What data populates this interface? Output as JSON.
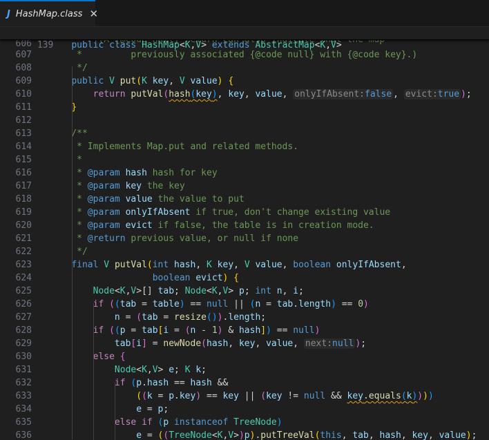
{
  "tab": {
    "label": "HashMap.class",
    "close_glyph": "✕",
    "icon_glyph": "J"
  },
  "sticky": {
    "line_number": "139",
    "parts": [
      [
        "k",
        "public"
      ],
      [
        "p",
        " "
      ],
      [
        "k",
        "class"
      ],
      [
        "p",
        " "
      ],
      [
        "t",
        "HashMap"
      ],
      [
        "p",
        "<"
      ],
      [
        "t",
        "K"
      ],
      [
        "p",
        ","
      ],
      [
        "t",
        "V"
      ],
      [
        "p",
        "> "
      ],
      [
        "k",
        "extends"
      ],
      [
        "p",
        " "
      ],
      [
        "t",
        "AbstractMap"
      ],
      [
        "p",
        "<"
      ],
      [
        "t",
        "K"
      ],
      [
        "p",
        ","
      ],
      [
        "t",
        "V"
      ],
      [
        "p",
        ">"
      ]
    ]
  },
  "lines": [
    {
      "n": "606",
      "clip": true,
      "parts": [
        [
          "cm",
          "         (A {@code null} return can also indicate that the map"
        ]
      ]
    },
    {
      "n": "607",
      "parts": [
        [
          "cm",
          "     *         previously associated {@code null} with {@code key}.)"
        ]
      ]
    },
    {
      "n": "608",
      "parts": [
        [
          "cm",
          "     */"
        ]
      ]
    },
    {
      "n": "609",
      "parts": [
        [
          "p",
          "    "
        ],
        [
          "k",
          "public"
        ],
        [
          "p",
          " "
        ],
        [
          "t",
          "V"
        ],
        [
          "p",
          " "
        ],
        [
          "f",
          "put"
        ],
        [
          "b1",
          "("
        ],
        [
          "t",
          "K"
        ],
        [
          "p",
          " "
        ],
        [
          "v",
          "key"
        ],
        [
          "p",
          ", "
        ],
        [
          "t",
          "V"
        ],
        [
          "p",
          " "
        ],
        [
          "v",
          "value"
        ],
        [
          "b1",
          ")"
        ],
        [
          "p",
          " "
        ],
        [
          "b1",
          "{"
        ]
      ]
    },
    {
      "n": "610",
      "parts": [
        [
          "p",
          "        "
        ],
        [
          "c",
          "return"
        ],
        [
          "p",
          " "
        ],
        [
          "f",
          "putVal"
        ],
        [
          "b2",
          "("
        ],
        [
          "squig",
          [
            [
              "f",
              "hash"
            ],
            [
              "b3",
              "("
            ],
            [
              "v",
              "key"
            ],
            [
              "b3",
              ")"
            ]
          ]
        ],
        [
          "p",
          ", "
        ],
        [
          "v",
          "key"
        ],
        [
          "p",
          ", "
        ],
        [
          "v",
          "value"
        ],
        [
          "p",
          ", "
        ],
        [
          "hint",
          [
            [
              "hn",
              "onlyIfAbsent:"
            ],
            [
              "hv",
              "false"
            ]
          ]
        ],
        [
          "p",
          ", "
        ],
        [
          "hint",
          [
            [
              "hn",
              "evict:"
            ],
            [
              "hv",
              "true"
            ]
          ]
        ],
        [
          "b2",
          ")"
        ],
        [
          "p",
          ";"
        ]
      ]
    },
    {
      "n": "611",
      "parts": [
        [
          "p",
          "    "
        ],
        [
          "b1",
          "}"
        ]
      ]
    },
    {
      "n": "612",
      "parts": []
    },
    {
      "n": "613",
      "parts": [
        [
          "cm",
          "    /**"
        ]
      ]
    },
    {
      "n": "614",
      "parts": [
        [
          "cm",
          "     * Implements Map.put and related methods."
        ]
      ]
    },
    {
      "n": "615",
      "parts": [
        [
          "cm",
          "     *"
        ]
      ]
    },
    {
      "n": "616",
      "parts": [
        [
          "cm",
          "     * "
        ],
        [
          "cmk",
          "@param"
        ],
        [
          "cm",
          " "
        ],
        [
          "v",
          "hash"
        ],
        [
          "cm",
          " hash for key"
        ]
      ]
    },
    {
      "n": "617",
      "parts": [
        [
          "cm",
          "     * "
        ],
        [
          "cmk",
          "@param"
        ],
        [
          "cm",
          " "
        ],
        [
          "v",
          "key"
        ],
        [
          "cm",
          " the key"
        ]
      ]
    },
    {
      "n": "618",
      "parts": [
        [
          "cm",
          "     * "
        ],
        [
          "cmk",
          "@param"
        ],
        [
          "cm",
          " "
        ],
        [
          "v",
          "value"
        ],
        [
          "cm",
          " the value to put"
        ]
      ]
    },
    {
      "n": "619",
      "parts": [
        [
          "cm",
          "     * "
        ],
        [
          "cmk",
          "@param"
        ],
        [
          "cm",
          " "
        ],
        [
          "v",
          "onlyIfAbsent"
        ],
        [
          "cm",
          " if true, don't change existing value"
        ]
      ]
    },
    {
      "n": "620",
      "parts": [
        [
          "cm",
          "     * "
        ],
        [
          "cmk",
          "@param"
        ],
        [
          "cm",
          " "
        ],
        [
          "v",
          "evict"
        ],
        [
          "cm",
          " if false, the table is in creation mode."
        ]
      ]
    },
    {
      "n": "621",
      "parts": [
        [
          "cm",
          "     * "
        ],
        [
          "cmk",
          "@return"
        ],
        [
          "cm",
          " previous value, or null if none"
        ]
      ]
    },
    {
      "n": "622",
      "parts": [
        [
          "cm",
          "     */"
        ]
      ]
    },
    {
      "n": "623",
      "parts": [
        [
          "p",
          "    "
        ],
        [
          "k",
          "final"
        ],
        [
          "p",
          " "
        ],
        [
          "t",
          "V"
        ],
        [
          "p",
          " "
        ],
        [
          "f",
          "putVal"
        ],
        [
          "b1",
          "("
        ],
        [
          "k",
          "int"
        ],
        [
          "p",
          " "
        ],
        [
          "v",
          "hash"
        ],
        [
          "p",
          ", "
        ],
        [
          "t",
          "K"
        ],
        [
          "p",
          " "
        ],
        [
          "v",
          "key"
        ],
        [
          "p",
          ", "
        ],
        [
          "t",
          "V"
        ],
        [
          "p",
          " "
        ],
        [
          "v",
          "value"
        ],
        [
          "p",
          ", "
        ],
        [
          "k",
          "boolean"
        ],
        [
          "p",
          " "
        ],
        [
          "v",
          "onlyIfAbsent"
        ],
        [
          "p",
          ","
        ]
      ]
    },
    {
      "n": "624",
      "parts": [
        [
          "p",
          "                   "
        ],
        [
          "k",
          "boolean"
        ],
        [
          "p",
          " "
        ],
        [
          "v",
          "evict"
        ],
        [
          "b1",
          ")"
        ],
        [
          "p",
          " "
        ],
        [
          "b1",
          "{"
        ]
      ]
    },
    {
      "n": "625",
      "parts": [
        [
          "p",
          "        "
        ],
        [
          "t",
          "Node"
        ],
        [
          "p",
          "<"
        ],
        [
          "t",
          "K"
        ],
        [
          "p",
          ","
        ],
        [
          "t",
          "V"
        ],
        [
          "p",
          ">[] "
        ],
        [
          "v",
          "tab"
        ],
        [
          "p",
          "; "
        ],
        [
          "t",
          "Node"
        ],
        [
          "p",
          "<"
        ],
        [
          "t",
          "K"
        ],
        [
          "p",
          ","
        ],
        [
          "t",
          "V"
        ],
        [
          "p",
          "> "
        ],
        [
          "v",
          "p"
        ],
        [
          "p",
          "; "
        ],
        [
          "k",
          "int"
        ],
        [
          "p",
          " "
        ],
        [
          "v",
          "n"
        ],
        [
          "p",
          ", "
        ],
        [
          "v",
          "i"
        ],
        [
          "p",
          ";"
        ]
      ]
    },
    {
      "n": "626",
      "parts": [
        [
          "p",
          "        "
        ],
        [
          "c",
          "if"
        ],
        [
          "p",
          " "
        ],
        [
          "b2",
          "("
        ],
        [
          "b3",
          "("
        ],
        [
          "v",
          "tab"
        ],
        [
          "p",
          " = "
        ],
        [
          "v",
          "table"
        ],
        [
          "b3",
          ")"
        ],
        [
          "p",
          " == "
        ],
        [
          "k",
          "null"
        ],
        [
          "p",
          " || "
        ],
        [
          "b3",
          "("
        ],
        [
          "v",
          "n"
        ],
        [
          "p",
          " = "
        ],
        [
          "v",
          "tab"
        ],
        [
          "p",
          "."
        ],
        [
          "v",
          "length"
        ],
        [
          "b3",
          ")"
        ],
        [
          "p",
          " == "
        ],
        [
          "n",
          "0"
        ],
        [
          "b2",
          ")"
        ]
      ]
    },
    {
      "n": "627",
      "parts": [
        [
          "p",
          "            "
        ],
        [
          "v",
          "n"
        ],
        [
          "p",
          " = "
        ],
        [
          "b2",
          "("
        ],
        [
          "v",
          "tab"
        ],
        [
          "p",
          " = "
        ],
        [
          "f",
          "resize"
        ],
        [
          "b3",
          "()"
        ],
        [
          "b2",
          ")"
        ],
        [
          "p",
          "."
        ],
        [
          "v",
          "length"
        ],
        [
          "p",
          ";"
        ]
      ]
    },
    {
      "n": "628",
      "parts": [
        [
          "p",
          "        "
        ],
        [
          "c",
          "if"
        ],
        [
          "p",
          " "
        ],
        [
          "b2",
          "("
        ],
        [
          "b3",
          "("
        ],
        [
          "v",
          "p"
        ],
        [
          "p",
          " = "
        ],
        [
          "v",
          "tab"
        ],
        [
          "b1",
          "["
        ],
        [
          "v",
          "i"
        ],
        [
          "p",
          " = "
        ],
        [
          "b2",
          "("
        ],
        [
          "v",
          "n"
        ],
        [
          "p",
          " - "
        ],
        [
          "n",
          "1"
        ],
        [
          "b2",
          ")"
        ],
        [
          "p",
          " & "
        ],
        [
          "v",
          "hash"
        ],
        [
          "b1",
          "]"
        ],
        [
          "b3",
          ")"
        ],
        [
          "p",
          " == "
        ],
        [
          "k",
          "null"
        ],
        [
          "b2",
          ")"
        ]
      ]
    },
    {
      "n": "629",
      "parts": [
        [
          "p",
          "            "
        ],
        [
          "v",
          "tab"
        ],
        [
          "b2",
          "["
        ],
        [
          "v",
          "i"
        ],
        [
          "b2",
          "]"
        ],
        [
          "p",
          " = "
        ],
        [
          "f",
          "newNode"
        ],
        [
          "b2",
          "("
        ],
        [
          "v",
          "hash"
        ],
        [
          "p",
          ", "
        ],
        [
          "v",
          "key"
        ],
        [
          "p",
          ", "
        ],
        [
          "v",
          "value"
        ],
        [
          "p",
          ", "
        ],
        [
          "hint",
          [
            [
              "hn",
              "next:"
            ],
            [
              "hv",
              "null"
            ]
          ]
        ],
        [
          "b2",
          ")"
        ],
        [
          "p",
          ";"
        ]
      ]
    },
    {
      "n": "630",
      "parts": [
        [
          "p",
          "        "
        ],
        [
          "c",
          "else"
        ],
        [
          "p",
          " "
        ],
        [
          "b2",
          "{"
        ]
      ]
    },
    {
      "n": "631",
      "parts": [
        [
          "p",
          "            "
        ],
        [
          "t",
          "Node"
        ],
        [
          "p",
          "<"
        ],
        [
          "t",
          "K"
        ],
        [
          "p",
          ","
        ],
        [
          "t",
          "V"
        ],
        [
          "p",
          "> "
        ],
        [
          "v",
          "e"
        ],
        [
          "p",
          "; "
        ],
        [
          "t",
          "K"
        ],
        [
          "p",
          " "
        ],
        [
          "v",
          "k"
        ],
        [
          "p",
          ";"
        ]
      ]
    },
    {
      "n": "632",
      "parts": [
        [
          "p",
          "            "
        ],
        [
          "c",
          "if"
        ],
        [
          "p",
          " "
        ],
        [
          "b3",
          "("
        ],
        [
          "v",
          "p"
        ],
        [
          "p",
          "."
        ],
        [
          "v",
          "hash"
        ],
        [
          "p",
          " == "
        ],
        [
          "v",
          "hash"
        ],
        [
          "p",
          " &&"
        ]
      ]
    },
    {
      "n": "633",
      "parts": [
        [
          "p",
          "                "
        ],
        [
          "b1",
          "("
        ],
        [
          "b2",
          "("
        ],
        [
          "v",
          "k"
        ],
        [
          "p",
          " = "
        ],
        [
          "v",
          "p"
        ],
        [
          "p",
          "."
        ],
        [
          "v",
          "key"
        ],
        [
          "b2",
          ")"
        ],
        [
          "p",
          " == "
        ],
        [
          "v",
          "key"
        ],
        [
          "p",
          " || "
        ],
        [
          "b2",
          "("
        ],
        [
          "v",
          "key"
        ],
        [
          "p",
          " != "
        ],
        [
          "k",
          "null"
        ],
        [
          "p",
          " && "
        ],
        [
          "squig",
          [
            [
              "v",
              "key"
            ],
            [
              "p",
              "."
            ],
            [
              "f",
              "equals"
            ],
            [
              "b3",
              "("
            ],
            [
              "v",
              "k"
            ],
            [
              "b3",
              ")"
            ]
          ]
        ],
        [
          "b2",
          ")"
        ],
        [
          "b1",
          ")"
        ],
        [
          "b3",
          ")"
        ]
      ]
    },
    {
      "n": "634",
      "parts": [
        [
          "p",
          "                "
        ],
        [
          "v",
          "e"
        ],
        [
          "p",
          " = "
        ],
        [
          "v",
          "p"
        ],
        [
          "p",
          ";"
        ]
      ]
    },
    {
      "n": "635",
      "parts": [
        [
          "p",
          "            "
        ],
        [
          "c",
          "else"
        ],
        [
          "p",
          " "
        ],
        [
          "c",
          "if"
        ],
        [
          "p",
          " "
        ],
        [
          "b3",
          "("
        ],
        [
          "v",
          "p"
        ],
        [
          "p",
          " "
        ],
        [
          "k",
          "instanceof"
        ],
        [
          "p",
          " "
        ],
        [
          "t",
          "TreeNode"
        ],
        [
          "b3",
          ")"
        ]
      ]
    },
    {
      "n": "636",
      "parts": [
        [
          "p",
          "                "
        ],
        [
          "v",
          "e"
        ],
        [
          "p",
          " = "
        ],
        [
          "b1",
          "("
        ],
        [
          "b2",
          "("
        ],
        [
          "t",
          "TreeNode"
        ],
        [
          "p",
          "<"
        ],
        [
          "t",
          "K"
        ],
        [
          "p",
          ","
        ],
        [
          "t",
          "V"
        ],
        [
          "p",
          ">"
        ],
        [
          "b2",
          ")"
        ],
        [
          "v",
          "p"
        ],
        [
          "b1",
          ")"
        ],
        [
          "p",
          "."
        ],
        [
          "f",
          "putTreeVal"
        ],
        [
          "b1",
          "("
        ],
        [
          "k",
          "this"
        ],
        [
          "p",
          ", "
        ],
        [
          "v",
          "tab"
        ],
        [
          "p",
          ", "
        ],
        [
          "v",
          "hash"
        ],
        [
          "p",
          ", "
        ],
        [
          "v",
          "key"
        ],
        [
          "p",
          ", "
        ],
        [
          "v",
          "value"
        ],
        [
          "b1",
          ")"
        ],
        [
          "p",
          ";"
        ]
      ]
    }
  ]
}
